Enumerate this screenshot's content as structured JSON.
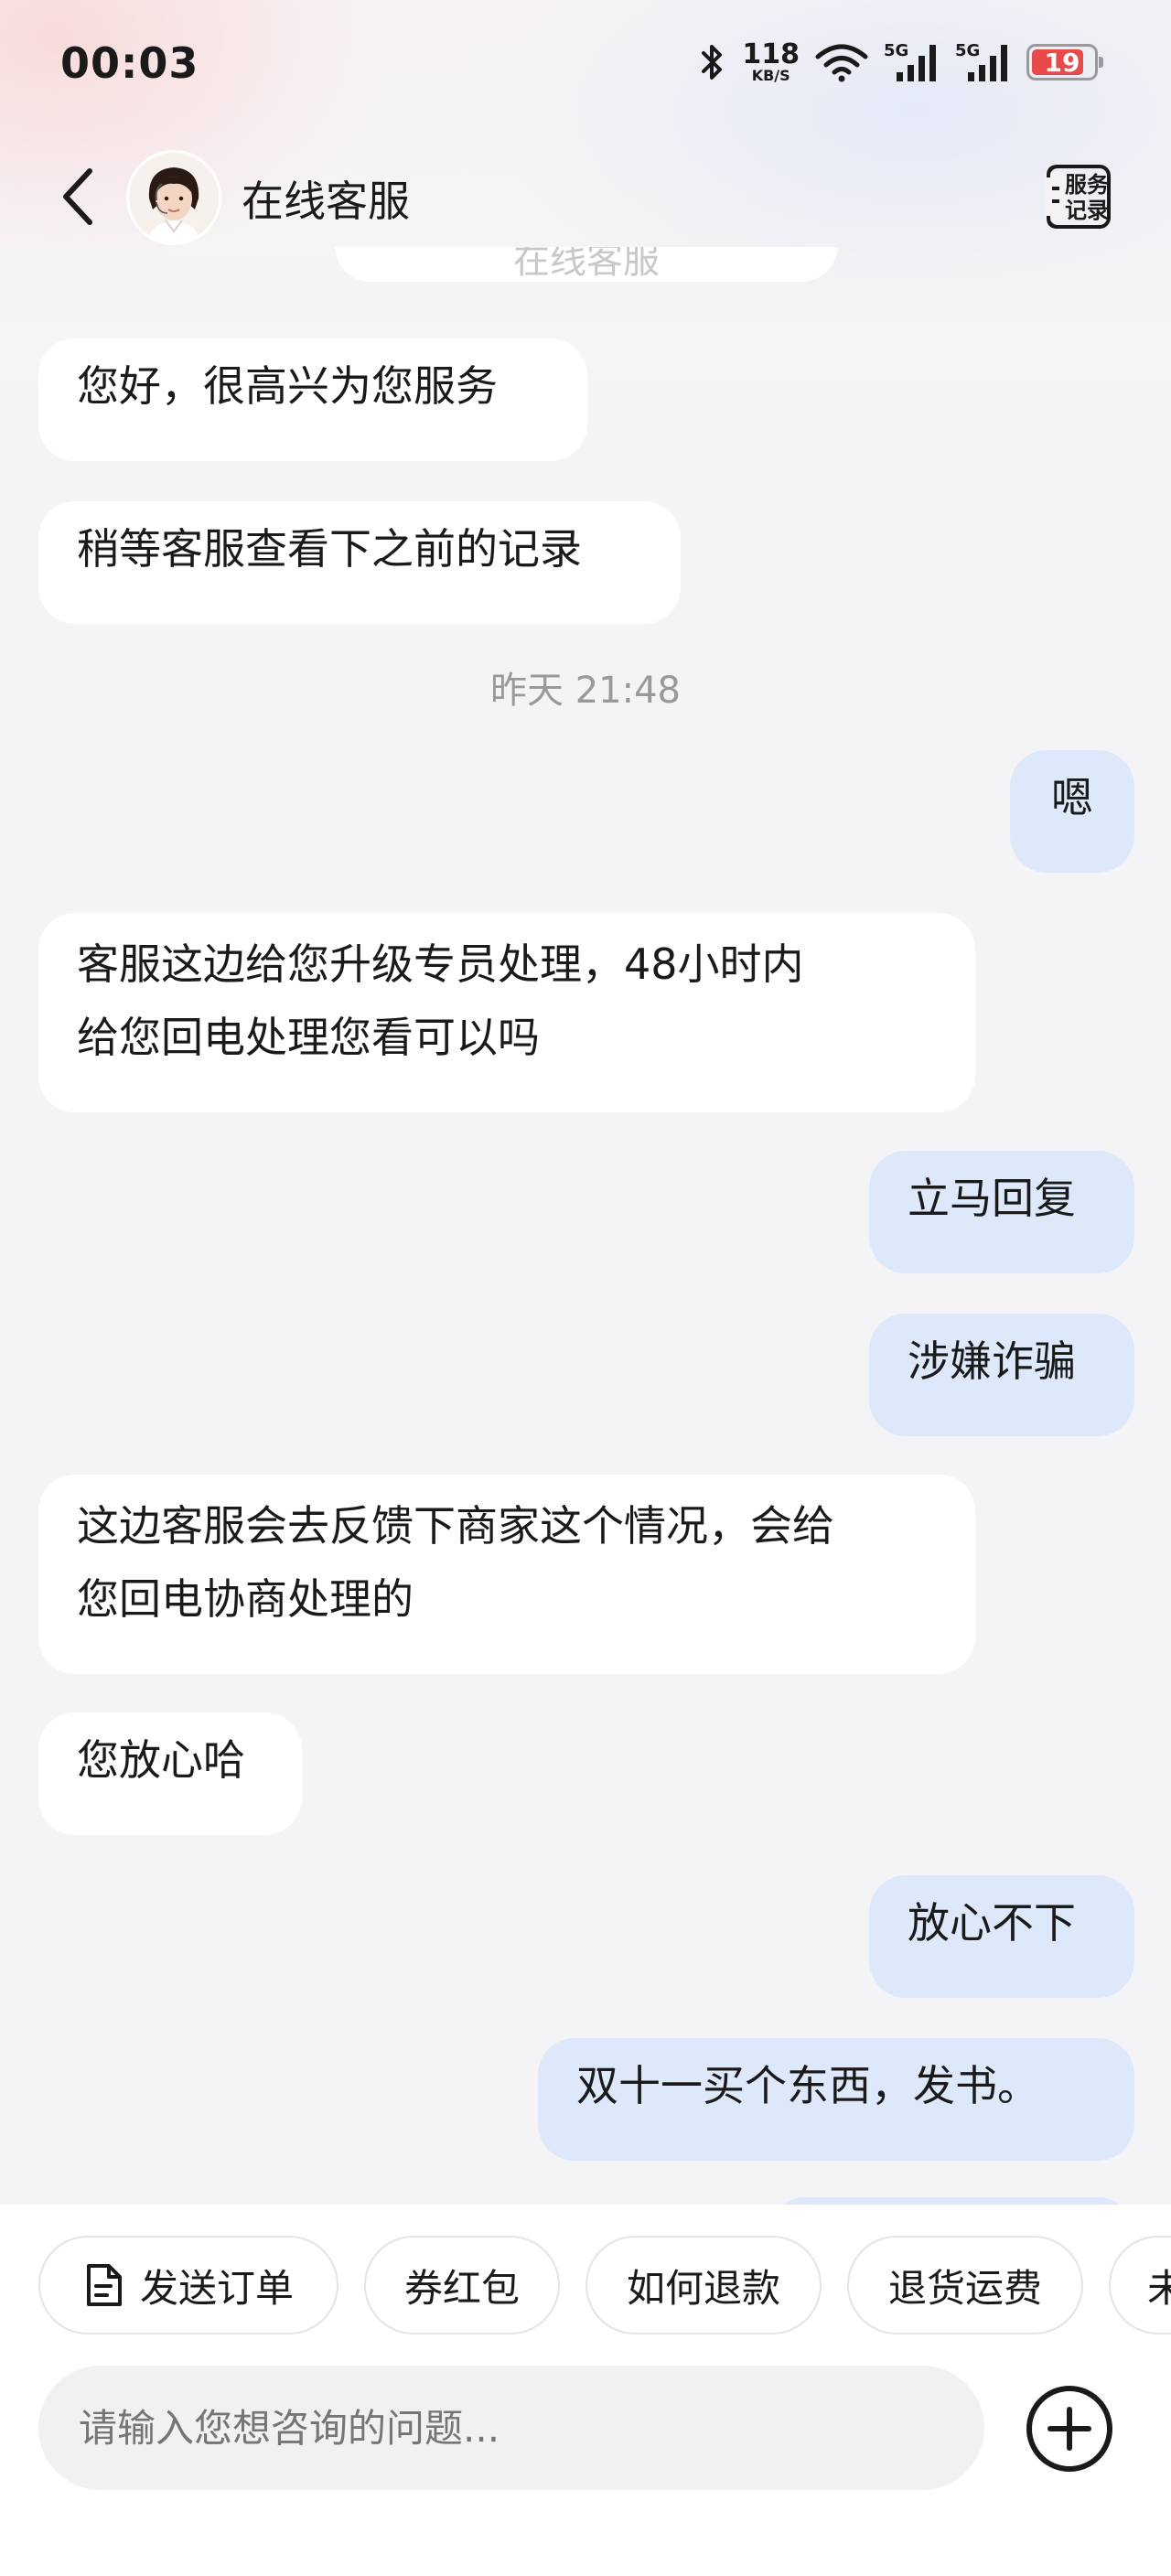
{
  "status_bar": {
    "time": "00:03",
    "net_speed_value": "118",
    "net_speed_unit": "KB/S",
    "signal_1_label": "5G",
    "signal_2_label": "5G",
    "battery_level": "19",
    "battery_color": "#e84a4a"
  },
  "header": {
    "title": "在线客服",
    "service_record_line1": "服务",
    "service_record_line2": "记录"
  },
  "chat": {
    "top_peek_text": "在线客服",
    "messages": [
      {
        "side": "in",
        "text": "您好，很高兴为您服务"
      },
      {
        "side": "in",
        "text": "稍等客服查看下之前的记录"
      },
      {
        "side": "out",
        "text": "嗯"
      },
      {
        "side": "in",
        "text": "客服这边给您升级专员处理，48小时内"
      },
      {
        "side": "in",
        "text": "给您回电处理您看可以吗"
      },
      {
        "side": "out",
        "text": "立马回复"
      },
      {
        "side": "out",
        "text": "涉嫌诈骗"
      },
      {
        "side": "in",
        "text": "这边客服会去反馈下商家这个情况，会给"
      },
      {
        "side": "in",
        "text": "您回电协商处理的"
      },
      {
        "side": "in",
        "text": "您放心哈"
      },
      {
        "side": "out",
        "text": "放心不下"
      },
      {
        "side": "out",
        "text": "双十一买个东西，发书。"
      }
    ],
    "timestamp": "昨天 21:48"
  },
  "quick_actions": [
    {
      "label": "发送订单",
      "icon": "document-icon"
    },
    {
      "label": "券红包"
    },
    {
      "label": "如何退款"
    },
    {
      "label": "退货运费"
    },
    {
      "label": "未"
    }
  ],
  "composer": {
    "placeholder": "请输入您想咨询的问题..."
  },
  "colors": {
    "outgoing_bubble": "#dde9fb",
    "incoming_bubble": "#ffffff",
    "background": "#f4f4f6"
  }
}
